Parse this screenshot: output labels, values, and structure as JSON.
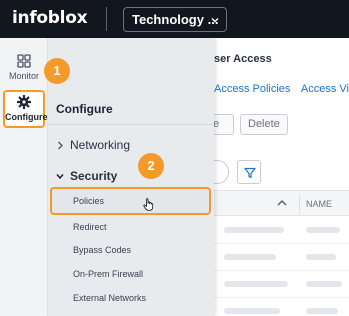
{
  "header": {
    "logo_text": "infoblox",
    "selector_label": "Technology ...",
    "selector_icon": "chevron-down-icon"
  },
  "rail": {
    "items": [
      {
        "label": "Monitor",
        "icon": "grid-icon"
      },
      {
        "label": "Configure",
        "icon": "gear-icon",
        "active": true
      }
    ]
  },
  "flyout": {
    "title": "Configure",
    "sections": [
      {
        "label": "Networking",
        "expanded": false
      },
      {
        "label": "Security",
        "expanded": true
      }
    ],
    "security_items": [
      "Policies",
      "Redirect",
      "Bypass Codes",
      "On-Prem Firewall",
      "External Networks"
    ]
  },
  "background": {
    "title_fragment": "ser Access",
    "links": [
      "Access Policies",
      "Access View"
    ],
    "buttons": {
      "edit_fragment": "e",
      "delete": "Delete"
    },
    "column_name": "NAME"
  },
  "annotations": {
    "step1": "1",
    "step2": "2"
  },
  "colors": {
    "accent": "#f39a2a",
    "topbar": "#12161f",
    "link": "#1a73c8"
  }
}
